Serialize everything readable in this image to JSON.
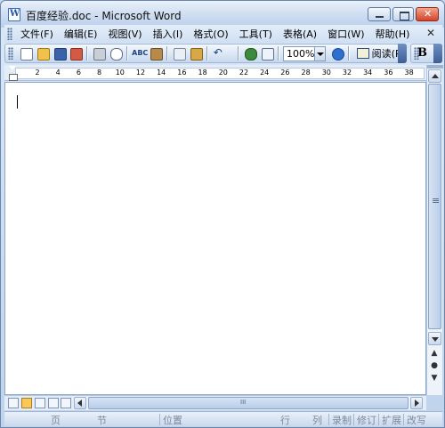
{
  "window": {
    "title": "百度经验.doc - Microsoft Word"
  },
  "menu": {
    "items": [
      {
        "label": "文件(F)"
      },
      {
        "label": "编辑(E)"
      },
      {
        "label": "视图(V)"
      },
      {
        "label": "插入(I)"
      },
      {
        "label": "格式(O)"
      },
      {
        "label": "工具(T)"
      },
      {
        "label": "表格(A)"
      },
      {
        "label": "窗口(W)"
      },
      {
        "label": "帮助(H)"
      }
    ],
    "close_doc": "✕"
  },
  "toolbar": {
    "zoom": "100%",
    "read_label": "阅读(R)",
    "bold_label": "B",
    "spell_glyph": "ABC",
    "undo_glyph": "↶"
  },
  "ruler": {
    "numbers": [
      "2",
      "4",
      "6",
      "8",
      "10",
      "12",
      "14",
      "16",
      "18",
      "20",
      "22",
      "24",
      "26",
      "28",
      "30",
      "32",
      "34",
      "36",
      "38"
    ]
  },
  "document": {
    "text": ""
  },
  "status": {
    "page": "页",
    "section": "节",
    "position": "位置",
    "line": "行",
    "column": "列",
    "record": "录制",
    "revise": "修订",
    "extend": "扩展",
    "overtype": "改写"
  },
  "colors": {
    "titlebar": "#cddcf0",
    "close_button": "#d4442a",
    "status_text": "#7c8aa0"
  }
}
